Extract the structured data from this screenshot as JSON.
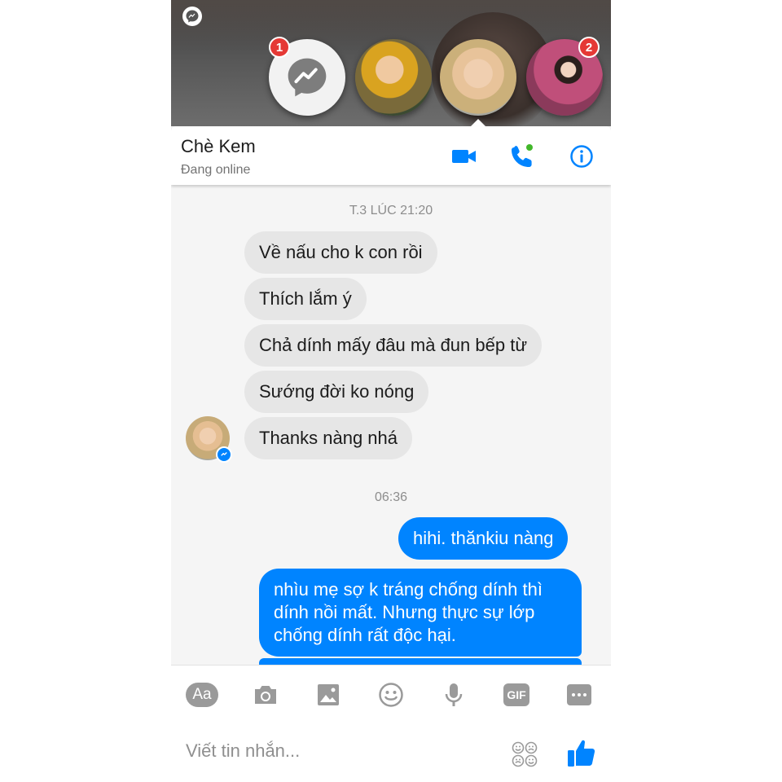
{
  "chat_heads": {
    "messenger_badge_count": "1",
    "contacts": [
      {
        "name": "contact-boy-yellow"
      },
      {
        "name": "contact-baby-beach"
      },
      {
        "name": "contact-woman-flowers",
        "badge_count": "2"
      }
    ]
  },
  "header": {
    "name": "Chè Kem",
    "status": "Đang online",
    "icons": [
      "video-call-icon",
      "voice-call-icon",
      "info-icon"
    ],
    "accent_color": "#0084ff"
  },
  "messages": {
    "stamp1": "T.3 LÚC 21:20",
    "incoming": [
      "Về nấu cho k con rồi",
      "Thích lắm ý",
      "Chả dính mấy đâu mà đun bếp từ",
      "Sướng đời ko nóng",
      "Thanks nàng nhá"
    ],
    "stamp2": "06:36",
    "outgoing": [
      "hihi. thănkiu nàng",
      "nhìu mẹ sợ k tráng chống dính thì dính nồi mất. Nhưng thực sự lớp chống dính rất độc hại."
    ]
  },
  "composer": {
    "aa_label": "Aa",
    "gif_label": "GIF",
    "placeholder": "Viết tin nhắn...",
    "tools": [
      "text-style-icon",
      "camera-icon",
      "image-icon",
      "emoji-icon",
      "microphone-icon",
      "gif-icon",
      "more-icon"
    ]
  }
}
